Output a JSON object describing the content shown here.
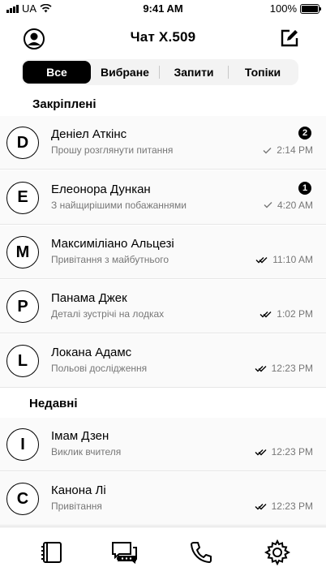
{
  "status_bar": {
    "carrier": "UA",
    "time": "9:41 AM",
    "battery": "100%",
    "battery_level": 1.0
  },
  "header": {
    "title": "Чат X.509",
    "profile_icon": "profile-icon",
    "compose_icon": "compose-icon"
  },
  "tabs": [
    {
      "label": "Все",
      "active": true
    },
    {
      "label": "Вибране",
      "active": false
    },
    {
      "label": "Запити",
      "active": false
    },
    {
      "label": "Топіки",
      "active": false
    }
  ],
  "sections": {
    "pinned": "Закріплені",
    "recent": "Недавні"
  },
  "pinned_chats": [
    {
      "initial": "D",
      "name": "Деніел Аткінс",
      "preview": "Прошу розглянути питання",
      "time": "2:14 PM",
      "status": "read",
      "badge": "2"
    },
    {
      "initial": "E",
      "name": "Елеонора Дункан",
      "preview": "З найщирішими побажаннями",
      "time": "4:20 AM",
      "status": "read",
      "badge": "1"
    },
    {
      "initial": "M",
      "name": "Максиміліано Альцезі",
      "preview": "Привітання з майбутнього",
      "time": "11:10 AM",
      "status": "delivered",
      "badge": ""
    },
    {
      "initial": "P",
      "name": "Панама Джек",
      "preview": "Деталі зустрічі на лодках",
      "time": "1:02 PM",
      "status": "delivered",
      "badge": ""
    },
    {
      "initial": "L",
      "name": "Локана Адамс",
      "preview": "Польові дослідження",
      "time": "12:23 PM",
      "status": "delivered",
      "badge": ""
    }
  ],
  "recent_chats": [
    {
      "initial": "I",
      "name": "Імам Дзен",
      "preview": "Виклик вчителя",
      "time": "12:23 PM",
      "status": "delivered",
      "badge": ""
    },
    {
      "initial": "C",
      "name": "Канона Лі",
      "preview": "Привітання",
      "time": "12:23 PM",
      "status": "delivered",
      "badge": ""
    }
  ],
  "bottom_nav": [
    "contacts-icon",
    "chats-icon",
    "phone-icon",
    "settings-icon"
  ]
}
